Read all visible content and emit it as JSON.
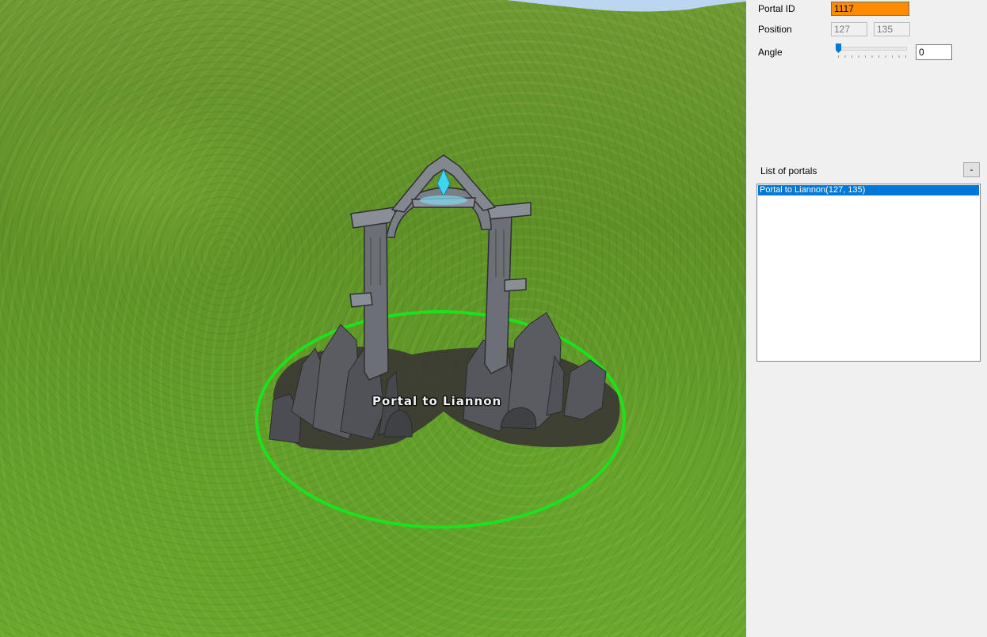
{
  "scene": {
    "portal_label": "Portal to Liannon",
    "selection_ring_color": "#1ee01e",
    "sky_color": "#bcd6f2"
  },
  "properties": {
    "portal_id_label": "Portal ID",
    "portal_id_value": "1117",
    "portal_id_bg": "#ff8c00",
    "position_label": "Position",
    "position_x": "127",
    "position_y": "135",
    "angle_label": "Angle",
    "angle_value": "0",
    "angle_slider_fraction": 0
  },
  "portal_list": {
    "title": "List of portals",
    "remove_label": "-",
    "items": [
      {
        "label": "Portal to Liannon(127, 135)",
        "selected": true
      }
    ]
  }
}
